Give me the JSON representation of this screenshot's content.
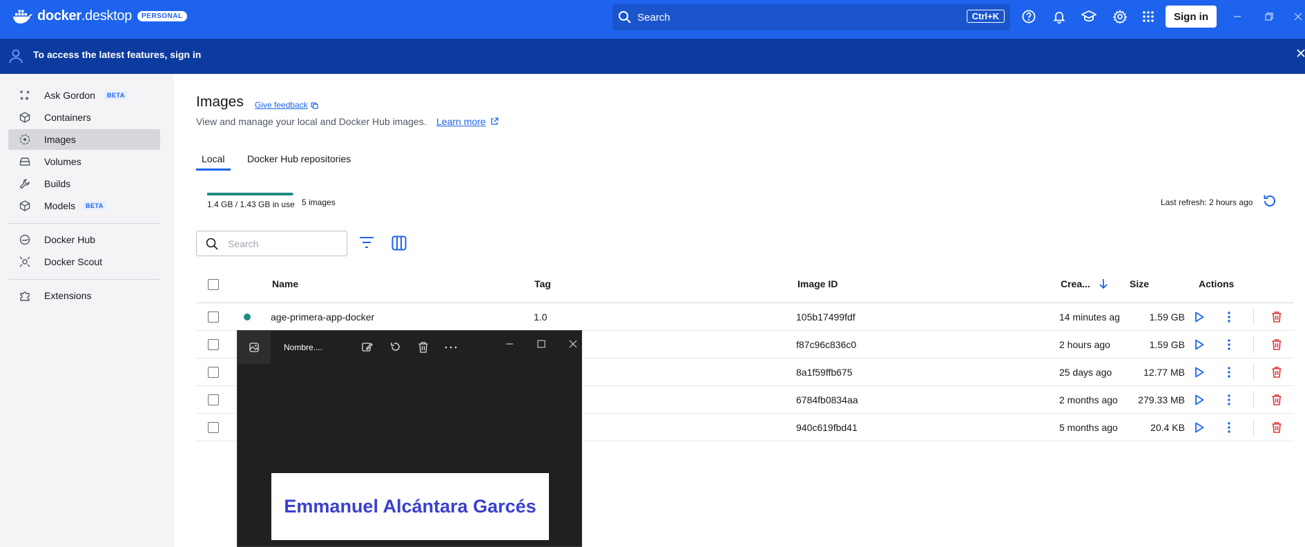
{
  "app": {
    "logo_text_bold": "docker",
    "logo_text_rest": ".desktop",
    "logo_badge": "PERSONAL",
    "search_label": "Search",
    "search_shortcut": "Ctrl+K",
    "signin_label": "Sign in",
    "brand_color": "#1d63ed"
  },
  "banner": {
    "text": "To access the latest features, sign in"
  },
  "sidebar": {
    "items": [
      {
        "label": "Ask Gordon",
        "badge": "BETA",
        "icon": "gordon-icon"
      },
      {
        "label": "Containers",
        "icon": "container-icon"
      },
      {
        "label": "Images",
        "icon": "image-layers-icon",
        "active": true
      },
      {
        "label": "Volumes",
        "icon": "volume-icon"
      },
      {
        "label": "Builds",
        "icon": "wrench-icon"
      },
      {
        "label": "Models",
        "badge": "BETA",
        "icon": "cube-icon"
      },
      {
        "label": "Docker Hub",
        "icon": "hub-icon"
      },
      {
        "label": "Docker Scout",
        "icon": "scout-icon"
      },
      {
        "label": "Extensions",
        "icon": "puzzle-icon"
      }
    ]
  },
  "page": {
    "title": "Images",
    "feedback_label": "Give feedback",
    "subtitle": "View and manage your local and Docker Hub images.",
    "learn_more": "Learn more",
    "tabs": [
      {
        "label": "Local",
        "active": true
      },
      {
        "label": "Docker Hub repositories"
      }
    ],
    "usage_text": "1.4 GB / 1.43 GB in use",
    "usage_fraction": 0.98,
    "images_count": "5 images",
    "last_refresh": "Last refresh: 2 hours ago",
    "search_placeholder": "Search"
  },
  "table": {
    "headers": {
      "name": "Name",
      "tag": "Tag",
      "image_id": "Image ID",
      "created": "Crea...",
      "size": "Size",
      "actions": "Actions"
    },
    "rows": [
      {
        "name": "age-primera-app-docker",
        "tag": "1.0",
        "image_id": "105b17499fdf",
        "created": "14 minutes ag",
        "size": "1.59 GB",
        "in_use": true
      },
      {
        "name": "",
        "tag": "",
        "image_id": "f87c96c836c0",
        "created": "2 hours ago",
        "size": "1.59 GB"
      },
      {
        "name": "",
        "tag": "",
        "image_id": "8a1f59ffb675",
        "created": "25 days ago",
        "size": "12.77 MB"
      },
      {
        "name": "",
        "tag": "",
        "image_id": "6784fb0834aa",
        "created": "2 months ago",
        "size": "279.33 MB"
      },
      {
        "name": "",
        "tag": "",
        "image_id": "940c619fbd41",
        "created": "5 months ago",
        "size": "20.4 KB"
      }
    ]
  },
  "photo_viewer": {
    "title": "Nombre....",
    "image_text": "Emmanuel Alcántara Garcés"
  }
}
